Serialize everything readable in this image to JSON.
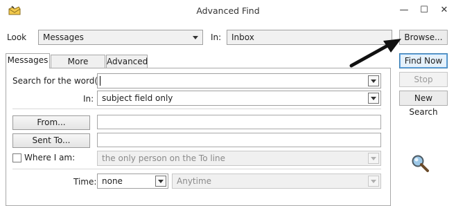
{
  "window": {
    "title": "Advanced Find",
    "controls": {
      "minimize": "—",
      "maximize": "☐",
      "close": "✕"
    }
  },
  "look": {
    "label": "Look",
    "value": "Messages"
  },
  "in": {
    "label": "In:",
    "value": "Inbox"
  },
  "buttons": {
    "browse": "Browse...",
    "find_now": "Find Now",
    "stop": "Stop",
    "new_search": "New Search"
  },
  "tabs": [
    {
      "label": "Messages",
      "active": true
    },
    {
      "label": "More Choices",
      "active": false
    },
    {
      "label": "Advanced",
      "active": false
    }
  ],
  "messages_tab": {
    "search_words_label": "Search for the word(s):",
    "search_words_value": "",
    "in_label": "In:",
    "in_value": "subject field only",
    "from_button": "From...",
    "from_value": "",
    "sent_to_button": "Sent To...",
    "sent_to_value": "",
    "where_i_am_label": "Where I am:",
    "where_i_am_checked": false,
    "where_i_am_value": "the only person on the To line",
    "time_label": "Time:",
    "time_value": "none",
    "time_range_value": "Anytime"
  },
  "icons": {
    "app": "envelope-icon",
    "search": "magnifier-icon",
    "annotation": "arrow-annotation"
  },
  "colors": {
    "primary_button_border": "#3c7fb1",
    "window_bg": "#ffffff",
    "magnifier_lens": "#9cc8e8"
  }
}
